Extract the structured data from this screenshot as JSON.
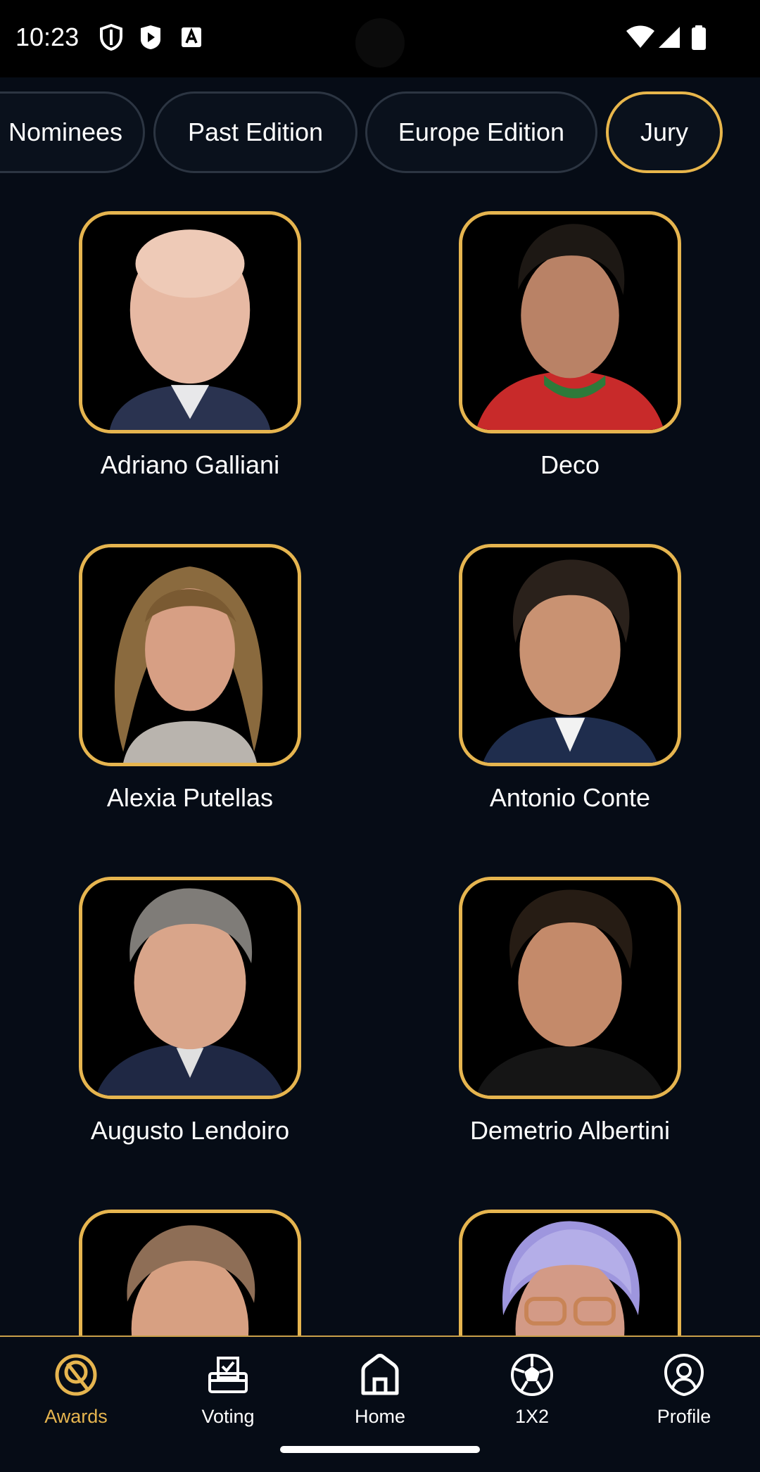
{
  "status_bar": {
    "time": "10:23",
    "icons": [
      "shield-icon",
      "play-icon",
      "a-letter-icon",
      "wifi-icon",
      "cellular-icon",
      "battery-icon"
    ]
  },
  "tabs": [
    {
      "label": "Nominees",
      "active": false
    },
    {
      "label": "Past Edition",
      "active": false
    },
    {
      "label": "Europe Edition",
      "active": false
    },
    {
      "label": "Jury",
      "active": true
    }
  ],
  "jury": [
    {
      "name": "Adriano Galliani"
    },
    {
      "name": "Deco"
    },
    {
      "name": "Alexia Putellas"
    },
    {
      "name": "Antonio Conte"
    },
    {
      "name": "Augusto Lendoiro"
    },
    {
      "name": "Demetrio Albertini"
    },
    {
      "name": ""
    },
    {
      "name": ""
    }
  ],
  "bottom_nav": [
    {
      "label": "Awards",
      "icon": "award-icon",
      "active": true
    },
    {
      "label": "Voting",
      "icon": "ballot-box-icon",
      "active": false
    },
    {
      "label": "Home",
      "icon": "home-icon",
      "active": false
    },
    {
      "label": "1X2",
      "icon": "football-icon",
      "active": false
    },
    {
      "label": "Profile",
      "icon": "profile-icon",
      "active": false
    }
  ],
  "colors": {
    "background": "#060c16",
    "accent_gold": "#e6b54f",
    "tab_border": "#2c3542",
    "text": "#ffffff"
  }
}
